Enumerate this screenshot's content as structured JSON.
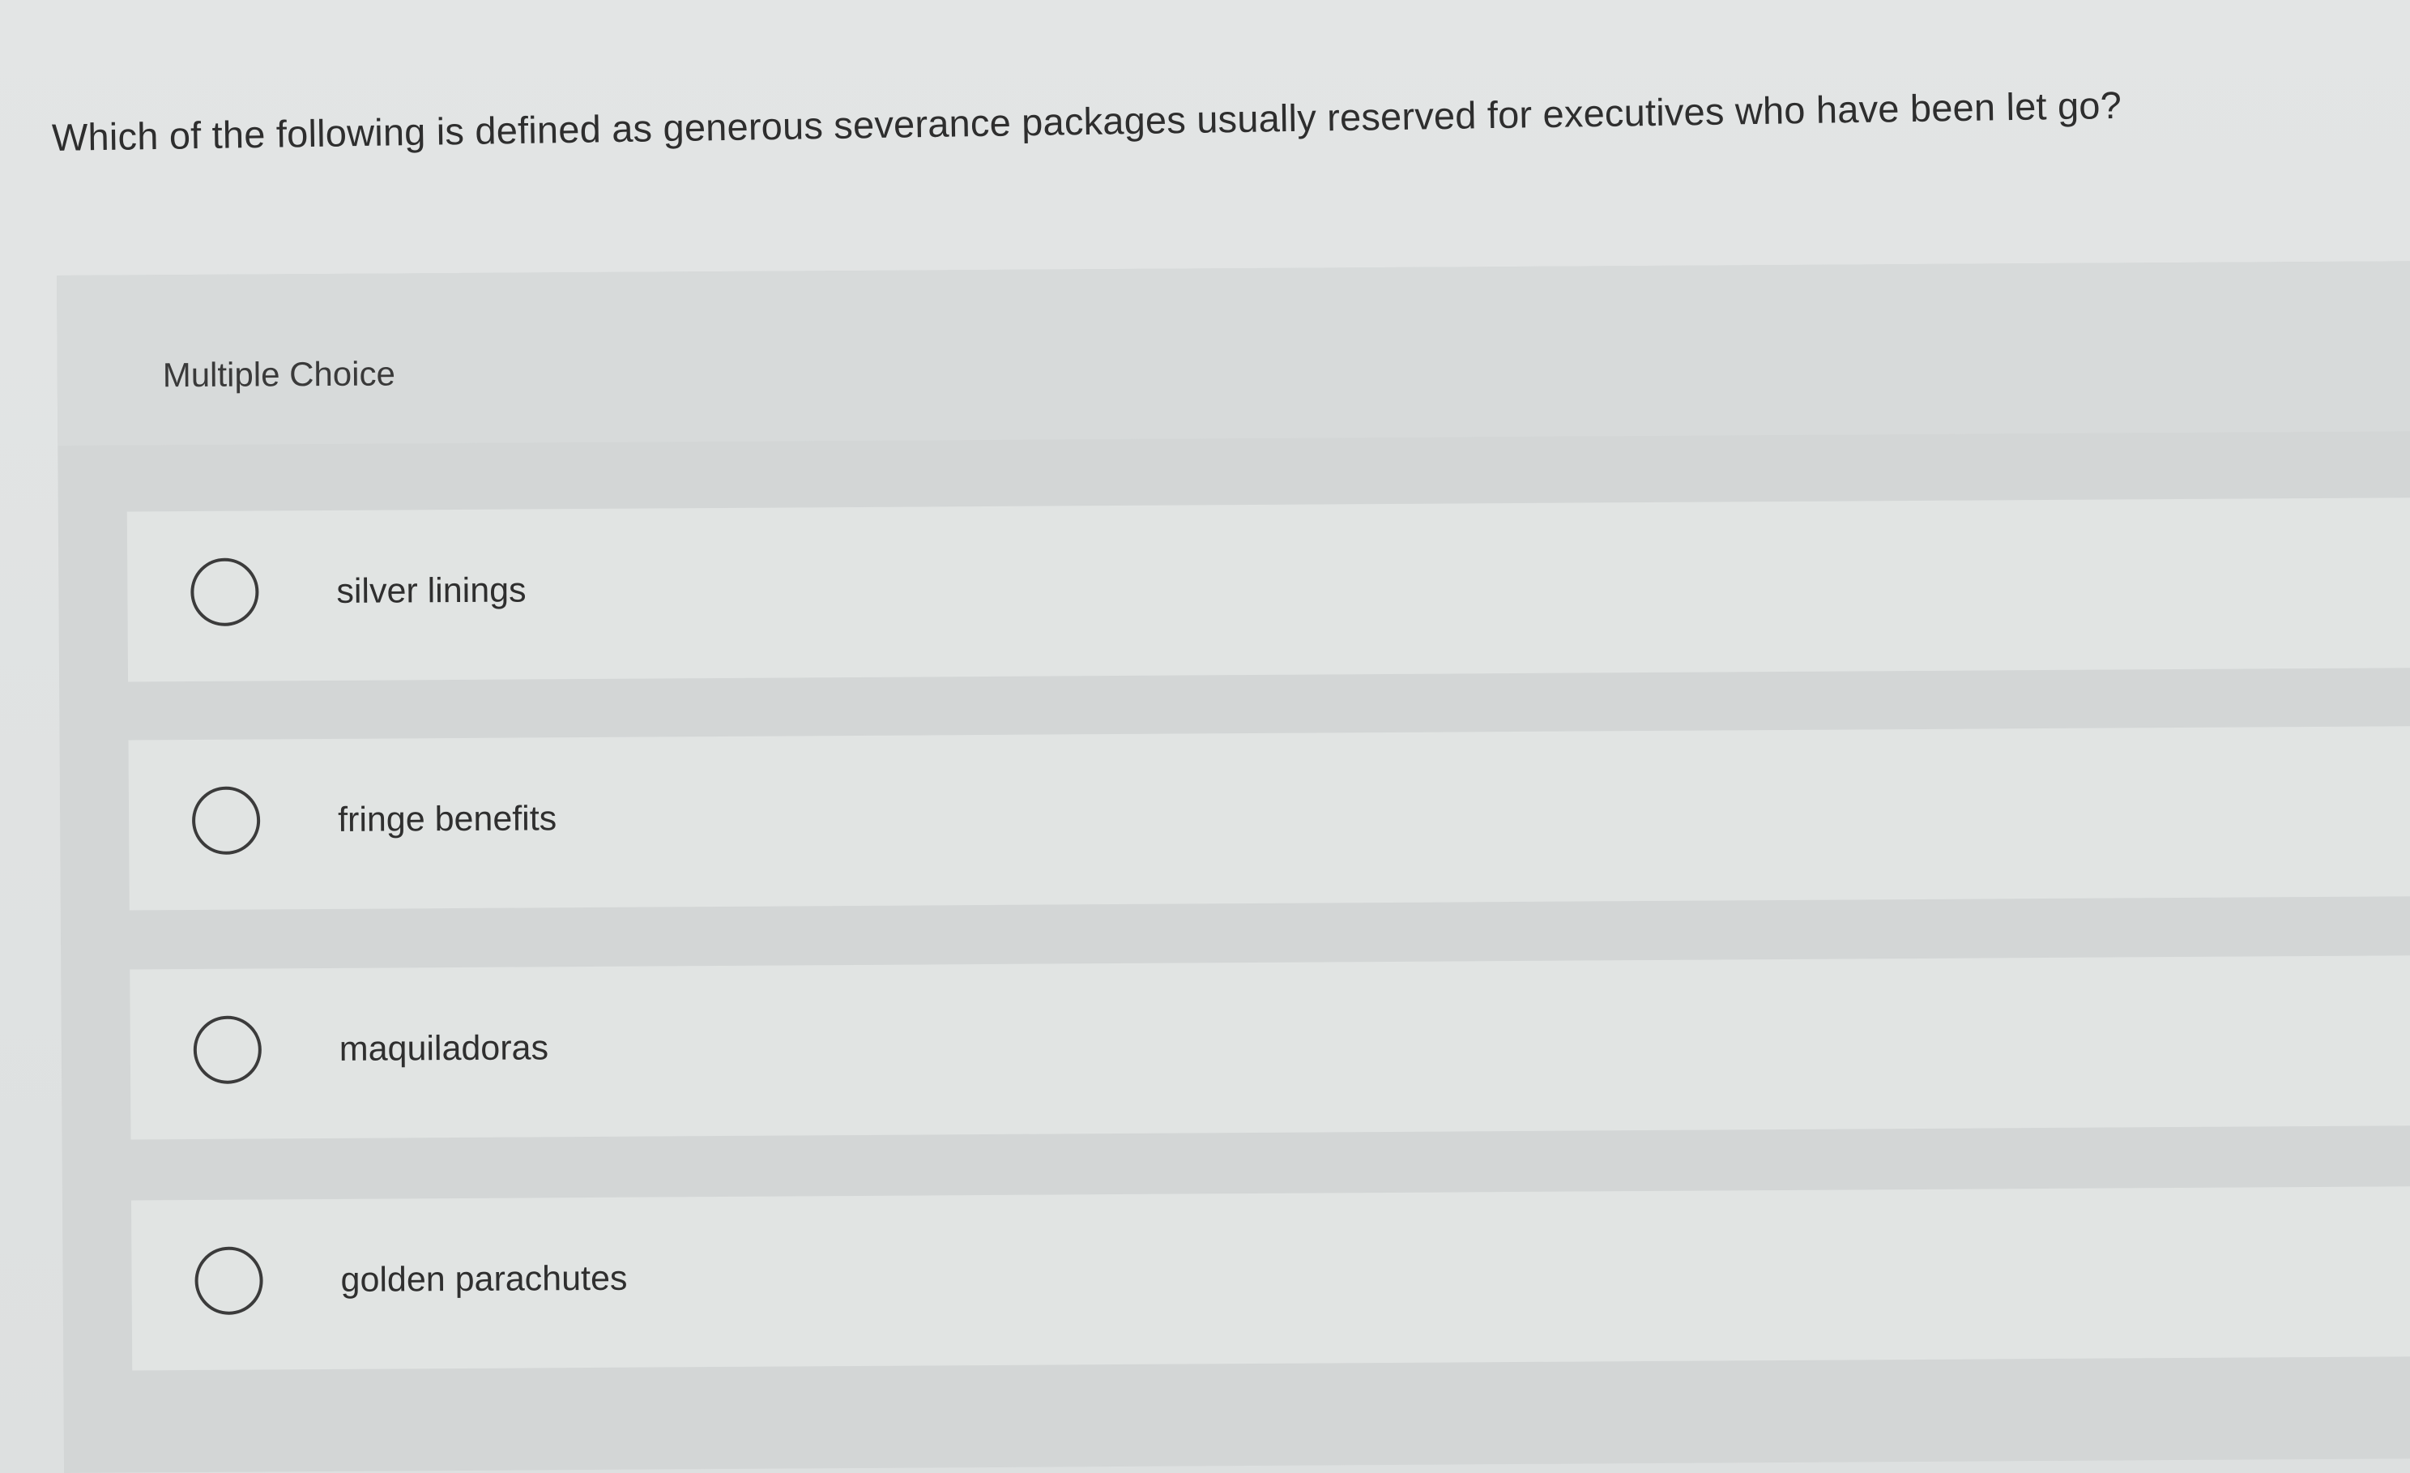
{
  "question": {
    "text": "Which of the following is defined as generous severance packages usually reserved for executives who have been let go?"
  },
  "multiple_choice": {
    "title": "Multiple Choice",
    "options": [
      {
        "label": "silver linings",
        "selected": false
      },
      {
        "label": "fringe benefits",
        "selected": false
      },
      {
        "label": "maquiladoras",
        "selected": false
      },
      {
        "label": "golden parachutes",
        "selected": false
      }
    ]
  },
  "colors": {
    "background": "#dfe1e1",
    "panel": "#d3d6d6",
    "option_background": "#e1e4e3",
    "text": "#2e2e2e",
    "radio_border": "#3b3b3b"
  },
  "icons": {
    "radio": "radio-unchecked-icon"
  }
}
